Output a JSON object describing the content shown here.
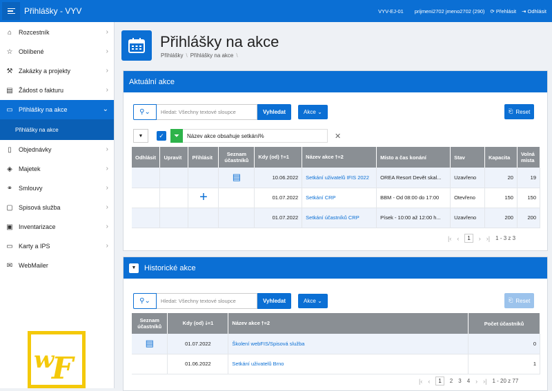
{
  "app": {
    "title": "Přihlášky - VYV",
    "env": "VYV-EJ-01",
    "user": "prijmeni2702 jmeno2702 (290)",
    "relogin": "Přehlásit",
    "logout": "Odhlásit"
  },
  "sidebar": {
    "items": [
      {
        "label": "Rozcestník",
        "icon": "home-icon"
      },
      {
        "label": "Oblíbené",
        "icon": "star-icon"
      },
      {
        "label": "Zakázky a projekty",
        "icon": "tools-icon"
      },
      {
        "label": "Žádost o fakturu",
        "icon": "document-icon"
      },
      {
        "label": "Přihlášky na akce",
        "icon": "card-icon"
      },
      {
        "label": "Objednávky",
        "icon": "clipboard-icon"
      },
      {
        "label": "Majetek",
        "icon": "box-icon"
      },
      {
        "label": "Smlouvy",
        "icon": "handshake-icon"
      },
      {
        "label": "Spisová služba",
        "icon": "file-icon"
      },
      {
        "label": "Inventarizace",
        "icon": "monitor-icon"
      },
      {
        "label": "Karty a IPS",
        "icon": "card-icon"
      },
      {
        "label": "WebMailer",
        "icon": "mail-icon"
      }
    ],
    "sub_item": "Přihlášky na akce"
  },
  "page": {
    "title": "Přihlášky na akce",
    "crumbs": [
      "Přihlášky",
      "Přihlášky na akce"
    ]
  },
  "region1": {
    "title": "Aktuální akce",
    "search_placeholder": "Hledat: Všechny textové sloupce",
    "find": "Vyhledat",
    "actions": "Akce",
    "reset": "Reset",
    "filter": "Název akce obsahuje setkání%",
    "headers": [
      "Odhlásit",
      "Upravit",
      "Přihlásit",
      "Seznam účastníků",
      "Kdy (od)",
      "Název akce",
      "Místo a čas konání",
      "Stav",
      "Kapacita",
      "Volná místa"
    ],
    "sort_kdy": "⭡≡1",
    "sort_nazev": "⭡≡2",
    "rows": [
      {
        "kdy": "10.06.2022",
        "nazev": "Setkání uživatelů IFIS 2022",
        "misto": "OREA Resort Devět skal...",
        "stav": "Uzavřeno",
        "kap": "20",
        "volna": "19"
      },
      {
        "kdy": "01.07.2022",
        "nazev": "Setkání CRP",
        "misto": "BBM - Od 08:00 do 17:00",
        "stav": "Otevřeno",
        "kap": "150",
        "volna": "150"
      },
      {
        "kdy": "01.07.2022",
        "nazev": "Setkání účastníků CRP",
        "misto": "Písek - 10:00 až 12:00 h...",
        "stav": "Uzavřeno",
        "kap": "200",
        "volna": "200"
      }
    ],
    "page": "1",
    "range": "1 - 3 z 3"
  },
  "region2": {
    "title": "Historické akce",
    "search_placeholder": "Hledat: Všechny textové sloupce",
    "find": "Vyhledat",
    "actions": "Akce",
    "reset": "Reset",
    "headers": [
      "Seznam účastníků",
      "Kdy (od)",
      "Název akce",
      "Počet účastníků"
    ],
    "sort_kdy": "⭣≡1",
    "sort_nazev": "⭡≡2",
    "rows": [
      {
        "kdy": "01.07.2022",
        "nazev": "Školení webFIS/Spisová služba",
        "pocet": "0"
      },
      {
        "kdy": "01.06.2022",
        "nazev": "Setkání uživatelů Brno",
        "pocet": "1"
      }
    ],
    "pages": [
      "1",
      "2",
      "3",
      "4"
    ],
    "range": "1 - 20 z 77"
  }
}
